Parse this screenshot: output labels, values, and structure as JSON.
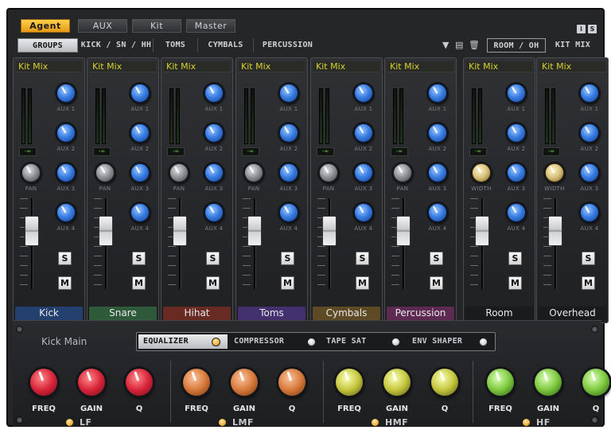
{
  "top_tabs": [
    {
      "label": "Agent",
      "active": true
    },
    {
      "label": "AUX",
      "active": false
    },
    {
      "label": "Kit",
      "active": false
    },
    {
      "label": "Master",
      "active": false
    }
  ],
  "window_buttons": [
    "i",
    "S"
  ],
  "group_tabs": [
    {
      "label": "GROUPS",
      "active": true
    },
    {
      "label": "KICK / SN / HH"
    },
    {
      "label": "TOMS"
    },
    {
      "label": "CYMBALS"
    },
    {
      "label": "PERCUSSION"
    }
  ],
  "right_tabs": [
    {
      "label": "ROOM / OH",
      "outline": true
    },
    {
      "label": "KIT MIX"
    }
  ],
  "channels": [
    {
      "kitmix": "Kit Mix",
      "name": "Kick",
      "color": "#24406e",
      "pan_label": "PAN",
      "pan_knob": "gray",
      "meter": "-∞"
    },
    {
      "kitmix": "Kit Mix",
      "name": "Snare",
      "color": "#2f5a3a",
      "pan_label": "PAN",
      "pan_knob": "gray",
      "meter": "-∞"
    },
    {
      "kitmix": "Kit Mix",
      "name": "Hihat",
      "color": "#6a2a24",
      "pan_label": "PAN",
      "pan_knob": "gray",
      "meter": "-∞"
    },
    {
      "kitmix": "Kit Mix",
      "name": "Toms",
      "color": "#43306e",
      "pan_label": "PAN",
      "pan_knob": "gray",
      "meter": "-∞"
    },
    {
      "kitmix": "Kit Mix",
      "name": "Cymbals",
      "color": "#5e4a24",
      "pan_label": "PAN",
      "pan_knob": "gray",
      "meter": "-∞"
    },
    {
      "kitmix": "Kit Mix",
      "name": "Percussion",
      "color": "#5e2a52",
      "pan_label": "PAN",
      "pan_knob": "gray",
      "meter": "-∞"
    },
    {
      "kitmix": "Kit Mix",
      "name": "Room",
      "color": "#1a1b1d",
      "pan_label": "WIDTH",
      "pan_knob": "tan",
      "meter": "-∞"
    },
    {
      "kitmix": "Kit Mix",
      "name": "Overhead",
      "color": "#1a1b1d",
      "pan_label": "WIDTH",
      "pan_knob": "tan",
      "meter": "-∞"
    }
  ],
  "aux_labels": [
    "AUX 1",
    "AUX 2",
    "AUX 3",
    "AUX 4"
  ],
  "solo_label": "S",
  "mute_label": "M",
  "fx": {
    "channel": "Kick Main",
    "tabs": [
      {
        "label": "EQUALIZER",
        "active": true,
        "led": true
      },
      {
        "label": "COMPRESSOR",
        "led": false
      },
      {
        "label": "TAPE SAT",
        "led": false
      },
      {
        "label": "ENV SHAPER",
        "led": false
      }
    ],
    "bands": [
      {
        "name": "LF",
        "color": "red",
        "knobs": [
          "FREQ",
          "GAIN",
          "Q"
        ]
      },
      {
        "name": "LMF",
        "color": "orange",
        "knobs": [
          "FREQ",
          "GAIN",
          "Q"
        ]
      },
      {
        "name": "HMF",
        "color": "yellow",
        "knobs": [
          "FREQ",
          "GAIN",
          "Q"
        ]
      },
      {
        "name": "HF",
        "color": "green",
        "knobs": [
          "FREQ",
          "GAIN",
          "Q"
        ]
      }
    ]
  }
}
